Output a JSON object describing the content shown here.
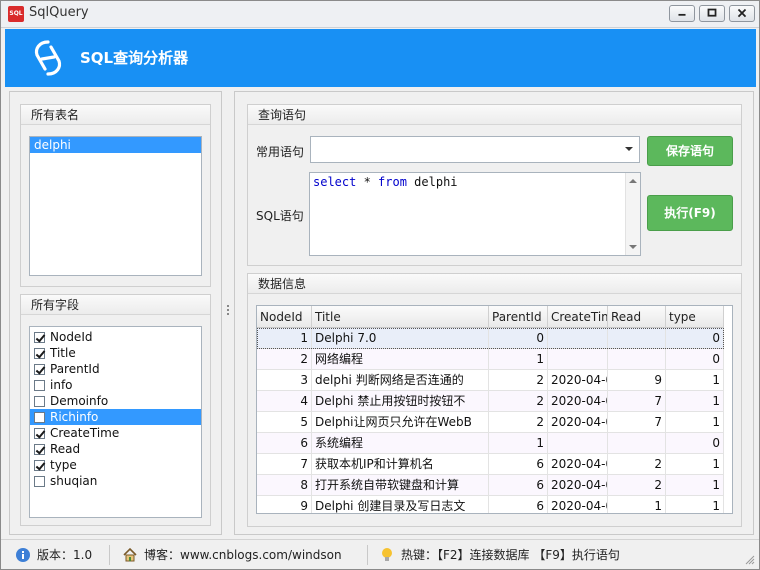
{
  "window": {
    "title": "SqlQuery",
    "app_icon_text": "SQL"
  },
  "banner": {
    "title": "SQL查询分析器"
  },
  "tables_group": {
    "title": "所有表名",
    "items": [
      "delphi"
    ],
    "selected": "delphi"
  },
  "fields_group": {
    "title": "所有字段",
    "items": [
      {
        "label": "NodeId",
        "checked": true
      },
      {
        "label": "Title",
        "checked": true
      },
      {
        "label": "ParentId",
        "checked": true
      },
      {
        "label": "info",
        "checked": false
      },
      {
        "label": "Demoinfo",
        "checked": false
      },
      {
        "label": "Richinfo",
        "checked": false,
        "selected": true
      },
      {
        "label": "CreateTime",
        "checked": true
      },
      {
        "label": "Read",
        "checked": true
      },
      {
        "label": "type",
        "checked": true
      },
      {
        "label": "shuqian",
        "checked": false
      }
    ]
  },
  "query_group": {
    "title": "查询语句",
    "common_label": "常用语句",
    "common_value": "",
    "sql_label": "SQL语句",
    "sql_text": {
      "kw1": "select",
      "mid1": " * ",
      "kw2": "from",
      "rest": " delphi"
    },
    "save_button": "保存语句",
    "execute_button": "执行(F9)"
  },
  "data_group": {
    "title": "数据信息",
    "columns": [
      "NodeId",
      "Title",
      "ParentId",
      "CreateTim",
      "Read",
      "type"
    ],
    "rows": [
      [
        "1",
        "Delphi 7.0",
        "0",
        "",
        "",
        "0"
      ],
      [
        "2",
        "网络编程",
        "1",
        "",
        "",
        "0"
      ],
      [
        "3",
        "delphi 判断网络是否连通的",
        "2",
        "2020-04-0",
        "9",
        "1"
      ],
      [
        "4",
        "Delphi 禁止用按钮时按钮不",
        "2",
        "2020-04-0",
        "7",
        "1"
      ],
      [
        "5",
        "Delphi让网页只允许在WebB",
        "2",
        "2020-04-0",
        "7",
        "1"
      ],
      [
        "6",
        "系统编程",
        "1",
        "",
        "",
        "0"
      ],
      [
        "7",
        "获取本机IP和计算机名",
        "6",
        "2020-04-0",
        "2",
        "1"
      ],
      [
        "8",
        "打开系统自带软键盘和计算",
        "6",
        "2020-04-0",
        "2",
        "1"
      ],
      [
        "9",
        "Delphi 创建目录及写日志文",
        "6",
        "2020-04-0",
        "1",
        "1"
      ]
    ]
  },
  "statusbar": {
    "version": "版本：1.0",
    "blog": "博客：www.cnblogs.com/windson",
    "hotkeys": "热键：【F2】连接数据库 【F9】执行语句"
  },
  "colors": {
    "banner": "#1890f4",
    "green_button": "#5cb85c",
    "selection": "#3399ff",
    "keyword": "#0000cc"
  }
}
